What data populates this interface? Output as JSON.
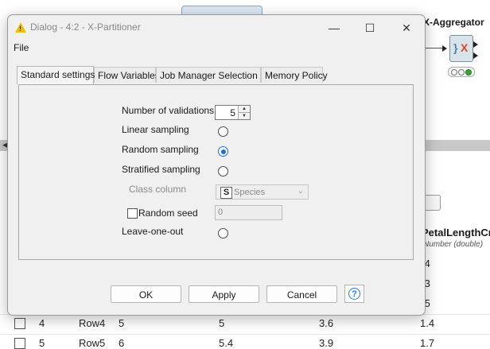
{
  "background": {
    "node_label": "X-Aggregator",
    "column_header": "PetalLengthCm",
    "column_subheader": "Number (double)",
    "partial_values": [
      ".4",
      ".3",
      ".5"
    ],
    "rows": [
      {
        "index": "4",
        "rowid": "Row4",
        "c1": "5",
        "c2": "5",
        "c3": "3.6",
        "c4": "1.4"
      },
      {
        "index": "5",
        "rowid": "Row5",
        "c1": "6",
        "c2": "5.4",
        "c3": "3.9",
        "c4": "1.7"
      }
    ]
  },
  "dialog": {
    "title": "Dialog - 4:2 - X-Partitioner",
    "menu_file": "File",
    "tabs": [
      "Standard settings",
      "Flow Variables",
      "Job Manager Selection",
      "Memory Policy"
    ],
    "number_of_validations_label": "Number of validations",
    "number_of_validations_value": "5",
    "linear_sampling_label": "Linear sampling",
    "random_sampling_label": "Random sampling",
    "stratified_sampling_label": "Stratified sampling",
    "class_column_label": "Class column",
    "class_column_value": "Species",
    "random_seed_label": "Random seed",
    "random_seed_value": "0",
    "leave_one_out_label": "Leave-one-out",
    "selected_sampling": "Random sampling",
    "ok_label": "OK",
    "apply_label": "Apply",
    "cancel_label": "Cancel"
  },
  "colors": {
    "accent": "#1f6fd1",
    "help": "#2b7fd4",
    "warning_icon": "#f0c000"
  }
}
